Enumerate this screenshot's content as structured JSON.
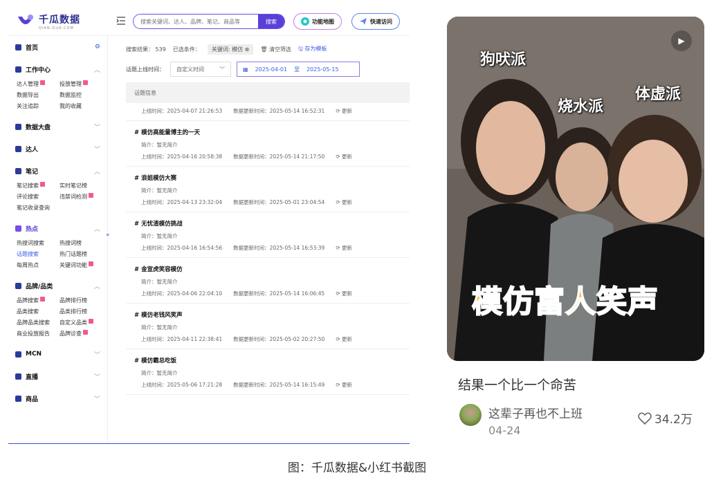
{
  "app": {
    "logo_title": "千瓜数据",
    "logo_sub": "QIAN-GUA.COM",
    "search_placeholder": "搜索关键词、达人、品牌、笔记、商品等",
    "search_button": "搜索",
    "map_button": "功能地图",
    "quick_button": "快速访问"
  },
  "sidebar": {
    "home": "首页",
    "workcenter": {
      "title": "工作中心",
      "items": [
        "达人管理",
        "投放管理",
        "数据导出",
        "数据监控",
        "关注追踪",
        "我的收藏"
      ]
    },
    "dashboard": "数据大盘",
    "kol": "达人",
    "notes": {
      "title": "笔记",
      "items": [
        "笔记搜索",
        "实时笔记榜",
        "评论搜索",
        "违禁词检测",
        "笔记收录查询"
      ]
    },
    "hot": {
      "title": "热点",
      "items": [
        "热搜词搜索",
        "热搜词榜",
        "话题搜索",
        "热门话题榜",
        "每周热点",
        "关键词功能"
      ]
    },
    "brand": {
      "title": "品牌/品类",
      "items": [
        "品牌搜索",
        "品牌排行榜",
        "品类搜索",
        "品类排行榜",
        "品牌品类搜索",
        "自定义品类",
        "商业投放报告",
        "品牌诊查"
      ]
    },
    "mcn": "MCN",
    "live": "直播",
    "goods": "商品"
  },
  "filters": {
    "result_label": "搜索结果：",
    "result_count": "539",
    "selected_label": "已选条件：",
    "chip": "关键词: 模仿",
    "clear": "清空筛选",
    "save": "存为模板",
    "time_label": "话题上线时间：",
    "time_select": "自定义时间",
    "date_from": "2025-04-01",
    "date_to_sep": "至",
    "date_to": "2025-05-15"
  },
  "table_header": "话题信息",
  "first_row": {
    "online": "上线时间：2025-04-07 21:26:53",
    "updated": "数据更新时间：2025-05-14 16:52:31",
    "refresh": "更新"
  },
  "topics": [
    {
      "title": "# 模仿高能量博主的一天",
      "desc": "简介：暂无简介",
      "online": "上线时间：2025-04-16 20:58:38",
      "updated": "数据更新时间：2025-05-14 21:17:50",
      "refresh": "更新"
    },
    {
      "title": "# 浪姐模仿大赛",
      "desc": "简介：暂无简介",
      "online": "上线时间：2025-04-13 23:32:04",
      "updated": "数据更新时间：2025-05-01 23:04:54",
      "refresh": "更新"
    },
    {
      "title": "# 无忧渣模仿挑战",
      "desc": "简介：暂无简介",
      "online": "上线时间：2025-04-16 16:54:56",
      "updated": "数据更新时间：2025-05-14 16:53:39",
      "refresh": "更新"
    },
    {
      "title": "# 金宣虎笑容模仿",
      "desc": "简介：暂无简介",
      "online": "上线时间：2025-04-06 22:04:10",
      "updated": "数据更新时间：2025-05-14 16:06:45",
      "refresh": "更新"
    },
    {
      "title": "# 模仿老钱风笑声",
      "desc": "简介：暂无简介",
      "online": "上线时间：2025-04-11 22:38:41",
      "updated": "数据更新时间：2025-05-02 20:27:50",
      "refresh": "更新"
    },
    {
      "title": "# 模仿霸总吃饭",
      "desc": "简介：暂无简介",
      "online": "上线时间：2025-05-06 17:21:28",
      "updated": "数据更新时间：2025-05-14 16:15:49",
      "refresh": "更新"
    }
  ],
  "xhs": {
    "label_left": "狗吠派",
    "label_mid": "烧水派",
    "label_right": "体虚派",
    "big_caption": "模仿富人笑声",
    "title": "结果一个比一个命苦",
    "author": "这辈子再也不上班",
    "date": "04-24",
    "likes": "34.2万"
  },
  "figure_caption": "图：千瓜数据&小红书截图"
}
